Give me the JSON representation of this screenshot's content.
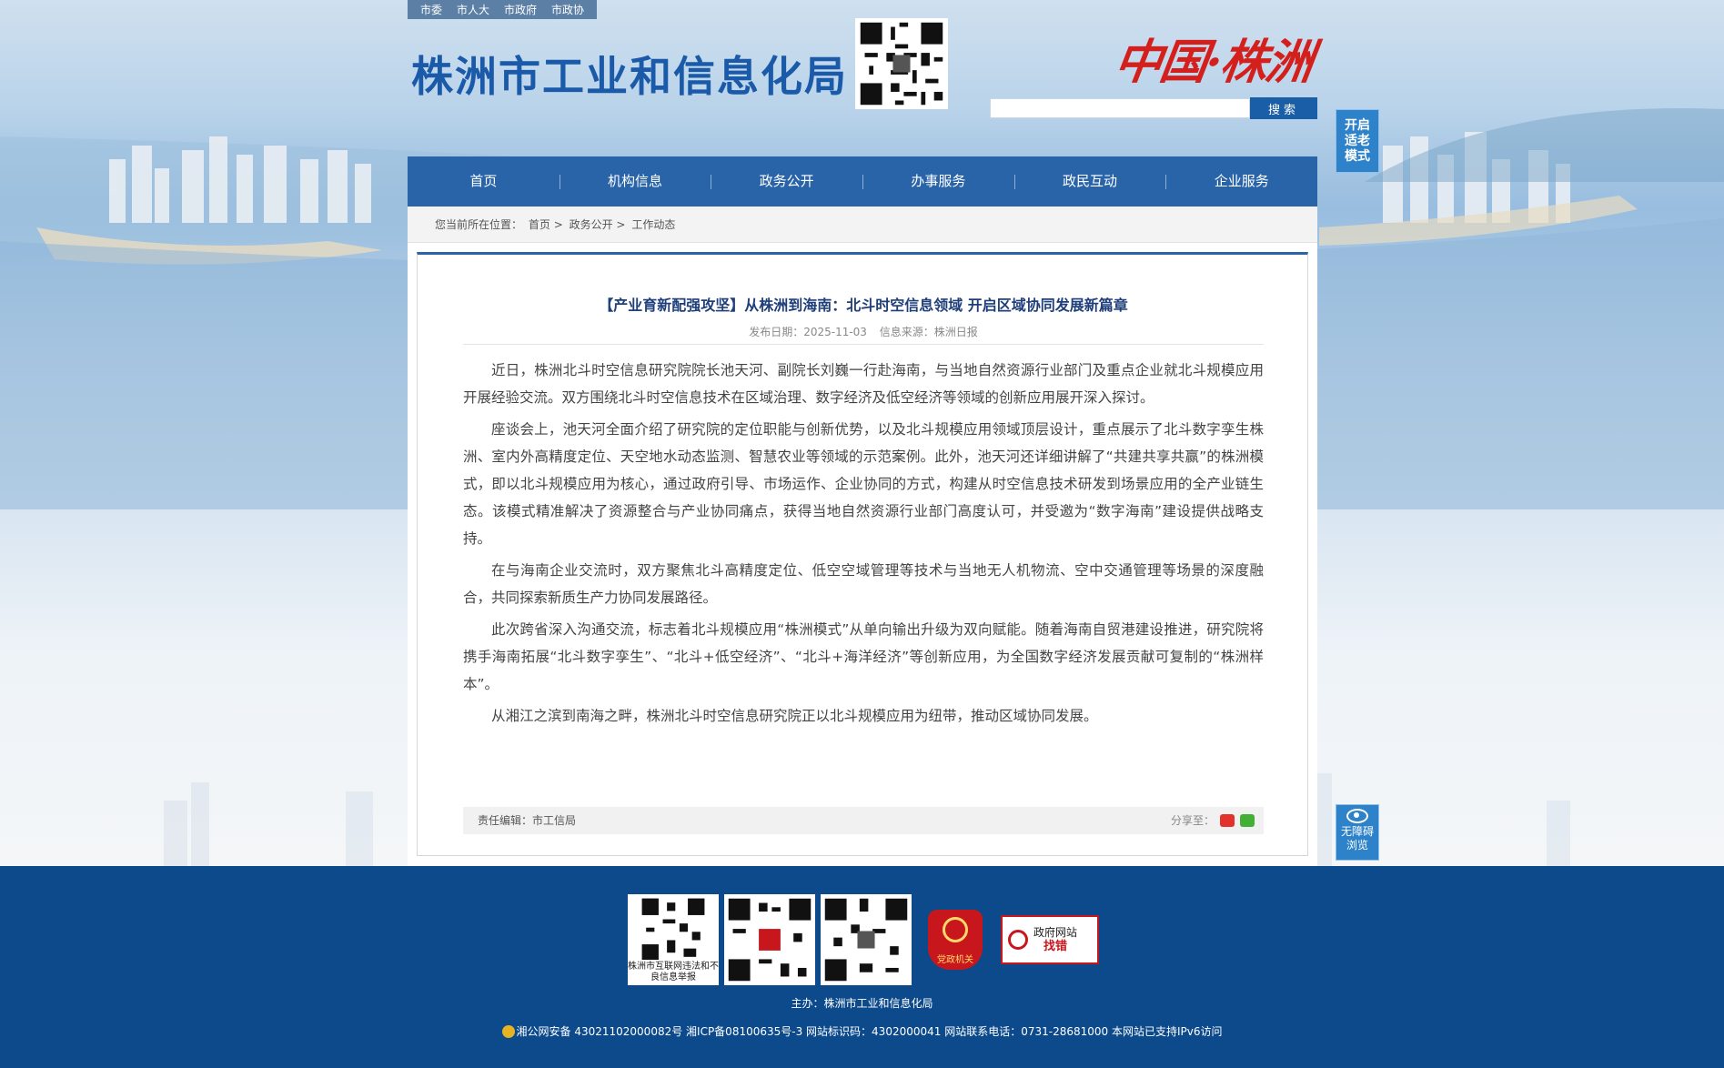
{
  "header": {
    "top_links": [
      "市委",
      "市人大",
      "市政府",
      "市政协"
    ],
    "site_title": "株洲市工业和信息化局",
    "calligraphy": "中国·株洲",
    "search_placeholder": "",
    "search_button": "搜索",
    "elder_mode": "开启适老模式",
    "accessibility": "无障碍浏览"
  },
  "nav": {
    "items": [
      "首页",
      "机构信息",
      "政务公开",
      "办事服务",
      "政民互动",
      "企业服务"
    ]
  },
  "breadcrumb": {
    "prefix": "您当前所在位置：",
    "items": [
      "首页",
      "政务公开",
      "工作动态"
    ],
    "separator": ">"
  },
  "article": {
    "title": "【产业育新配强攻坚】从株洲到海南：北斗时空信息领域 开启区域协同发展新篇章",
    "date_label": "发布日期：2025-11-03",
    "source_label": "信息来源：株洲日报",
    "paragraphs": [
      "近日，株洲北斗时空信息研究院院长池天河、副院长刘巍一行赴海南，与当地自然资源行业部门及重点企业就北斗规模应用开展经验交流。双方围绕北斗时空信息技术在区域治理、数字经济及低空经济等领域的创新应用展开深入探讨。",
      "座谈会上，池天河全面介绍了研究院的定位职能与创新优势，以及北斗规模应用领域顶层设计，重点展示了北斗数字孪生株洲、室内外高精度定位、天空地水动态监测、智慧农业等领域的示范案例。此外，池天河还详细讲解了“共建共享共赢”的株洲模式，即以北斗规模应用为核心，通过政府引导、市场运作、企业协同的方式，构建从时空信息技术研发到场景应用的全产业链生态。该模式精准解决了资源整合与产业协同痛点，获得当地自然资源行业部门高度认可，并受邀为“数字海南”建设提供战略支持。",
      "在与海南企业交流时，双方聚焦北斗高精度定位、低空空域管理等技术与当地无人机物流、空中交通管理等场景的深度融合，共同探索新质生产力协同发展路径。",
      "此次跨省深入沟通交流，标志着北斗规模应用“株洲模式”从单向输出升级为双向赋能。随着海南自贸港建设推进，研究院将携手海南拓展“北斗数字孪生”、“北斗+低空经济”、“北斗+海洋经济”等创新应用，为全国数字经济发展贡献可复制的“株洲样本”。",
      "从湘江之滨到南海之畔，株洲北斗时空信息研究院正以北斗规模应用为纽带，推动区域协同发展。"
    ],
    "editor_label": "责任编辑：市工信局",
    "share_label": "分享至："
  },
  "footer": {
    "report_label": "株洲市互联网违法和不良信息举报",
    "party_label": "党政机关",
    "jiucuo_top": "政府网站",
    "jiucuo_bottom": "找错",
    "host": "主办：株洲市工业和信息化局",
    "icp": "湘公网安备 43021102000082号 湘ICP备08100635号-3 网站标识码：4302000041 网站联系电话：0731-28681000 本网站已支持IPv6访问"
  },
  "colors": {
    "nav_bg": "#2a64a8",
    "footer_bg": "#0c4a8c",
    "title_blue": "#1b5aa8",
    "accent_red": "#d3201c"
  }
}
